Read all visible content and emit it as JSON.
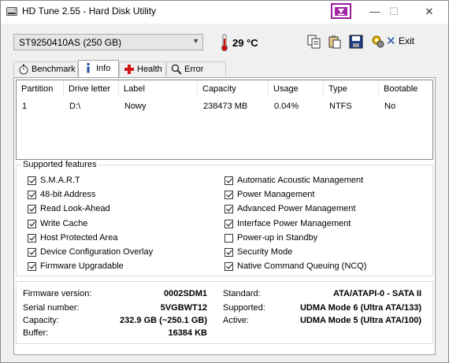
{
  "window": {
    "title": "HD Tune 2.55 - Hard Disk Utility",
    "minimize": "—",
    "maximize": "☐",
    "close": "✕"
  },
  "toolbar": {
    "drive": "ST9250410AS (250 GB)",
    "temperature": "29 °C",
    "exit_label": "Exit",
    "exit_icon": "✕"
  },
  "tabs": [
    "Benchmark",
    "Info",
    "Health",
    "Error Scan"
  ],
  "partitions": {
    "columns": [
      "Partition",
      "Drive letter",
      "Label",
      "Capacity",
      "Usage",
      "Type",
      "Bootable"
    ],
    "rows": [
      [
        "1",
        "D:\\",
        "Nowy",
        "238473 MB",
        "0.04%",
        "NTFS",
        "No"
      ]
    ]
  },
  "features": {
    "title": "Supported features",
    "left": [
      {
        "label": "S.M.A.R.T",
        "checked": true
      },
      {
        "label": "48-bit Address",
        "checked": true
      },
      {
        "label": "Read Look-Ahead",
        "checked": true
      },
      {
        "label": "Write Cache",
        "checked": true
      },
      {
        "label": "Host Protected Area",
        "checked": true
      },
      {
        "label": "Device Configuration Overlay",
        "checked": true
      },
      {
        "label": "Firmware Upgradable",
        "checked": true
      }
    ],
    "right": [
      {
        "label": "Automatic Acoustic Management",
        "checked": true
      },
      {
        "label": "Power Management",
        "checked": true
      },
      {
        "label": "Advanced Power Management",
        "checked": true
      },
      {
        "label": "Interface Power Management",
        "checked": true
      },
      {
        "label": "Power-up in Standby",
        "checked": false
      },
      {
        "label": "Security Mode",
        "checked": true
      },
      {
        "label": "Native Command Queuing (NCQ)",
        "checked": true
      }
    ]
  },
  "info": {
    "firmware_label": "Firmware version:",
    "firmware": "0002SDM1",
    "serial_label": "Serial number:",
    "serial": "5VGBWT12",
    "capacity_label": "Capacity:",
    "capacity": "232.9 GB (~250.1 GB)",
    "buffer_label": "Buffer:",
    "buffer": "16384 KB",
    "standard_label": "Standard:",
    "standard": "ATA/ATAPI-0 - SATA II",
    "supported_label": "Supported:",
    "supported": "UDMA Mode 6 (Ultra ATA/133)",
    "active_label": "Active:",
    "active": "UDMA Mode 5 (Ultra ATA/100)"
  },
  "colors": {
    "special_border": "#9a1b9a",
    "accent": "#1a4fa0"
  }
}
